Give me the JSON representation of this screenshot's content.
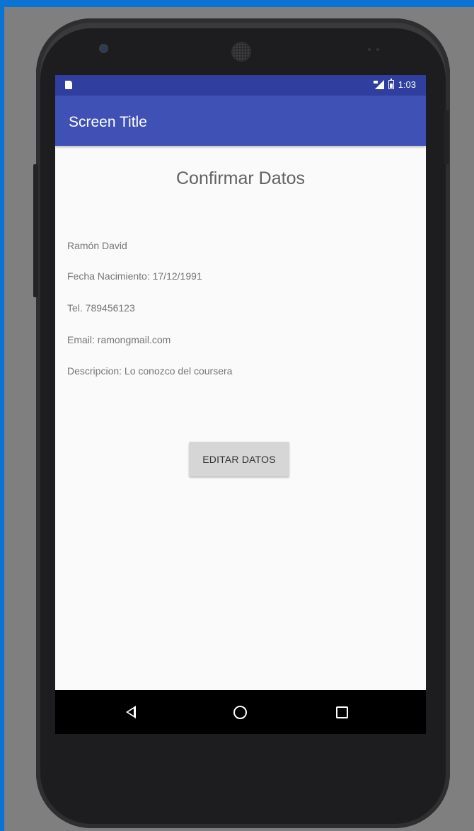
{
  "app_bar": {
    "title": "Screen Title"
  },
  "status_bar": {
    "time": "1:03"
  },
  "main": {
    "heading": "Confirmar Datos",
    "info_lines": [
      "Ramón David",
      "Fecha Nacimiento: 17/12/1991",
      "Tel. 789456123",
      "Email: ramongmail.com",
      "Descripcion: Lo conozco del coursera"
    ],
    "edit_button_label": "EDITAR DATOS"
  },
  "nav_bar": {
    "icons": [
      "back-icon",
      "home-icon",
      "recents-icon"
    ]
  },
  "colors": {
    "status_bar": "#303f9f",
    "app_bar": "#3f51b5",
    "screen_bg": "#fafafa",
    "button_bg": "#d6d6d6"
  }
}
